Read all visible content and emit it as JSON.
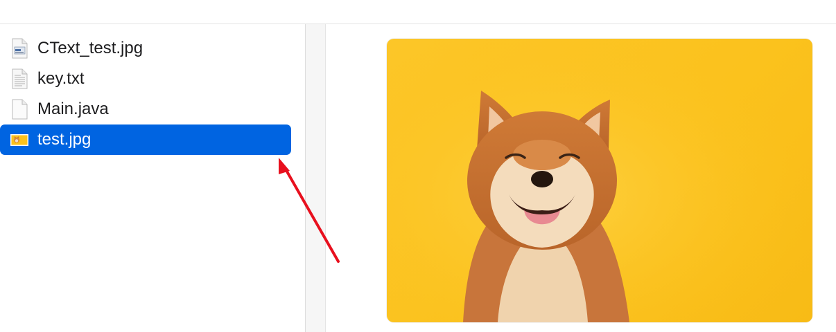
{
  "files": [
    {
      "name": "CText_test.jpg",
      "icon": "image-file-icon",
      "selected": false
    },
    {
      "name": "key.txt",
      "icon": "text-file-icon",
      "selected": false
    },
    {
      "name": "Main.java",
      "icon": "blank-file-icon",
      "selected": false
    },
    {
      "name": "test.jpg",
      "icon": "jpg-thumbnail-icon",
      "selected": true
    }
  ],
  "colors": {
    "selection": "#0064e1",
    "preview_background": "#fcc628",
    "arrow": "#e8101e"
  }
}
